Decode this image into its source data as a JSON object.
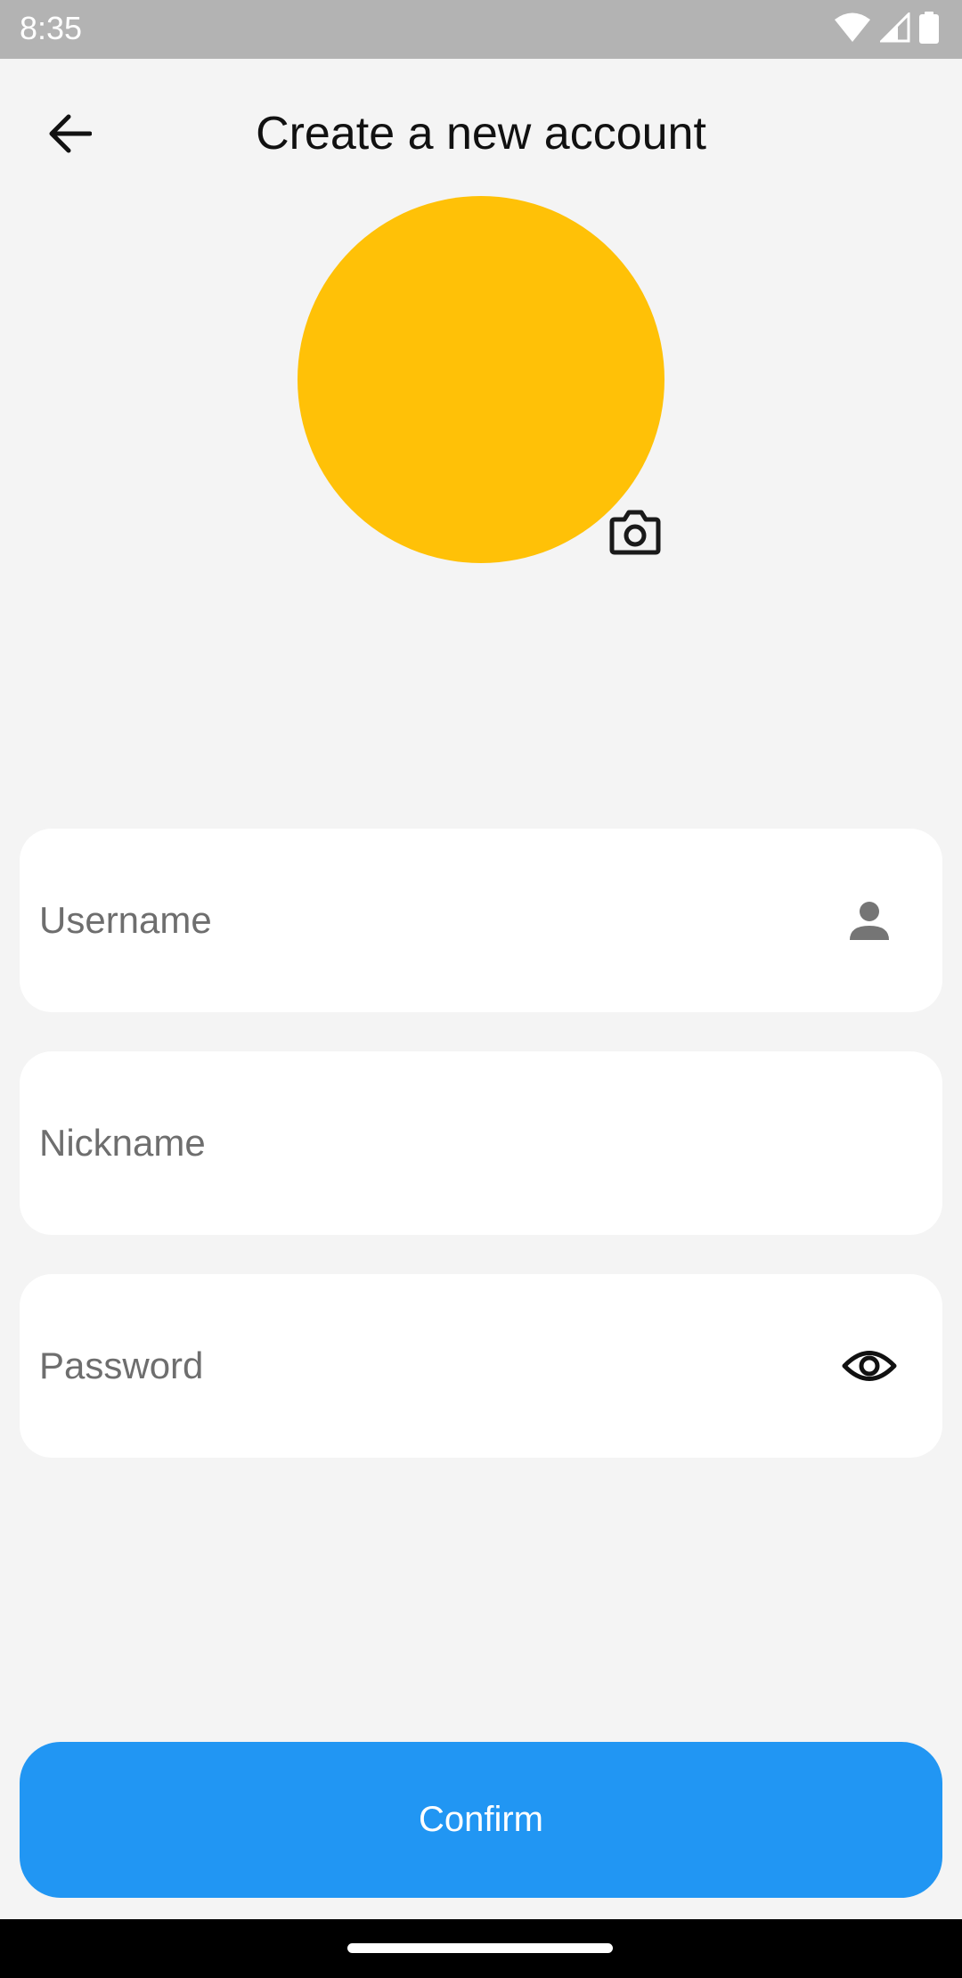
{
  "status_bar": {
    "time": "8:35",
    "icons": [
      "wifi-icon",
      "signal-icon",
      "battery-icon"
    ]
  },
  "header": {
    "title": "Create a new account",
    "back_icon": "arrow-back-icon"
  },
  "avatar": {
    "color": "#FFC107",
    "camera_icon": "camera-icon"
  },
  "form": {
    "username": {
      "placeholder": "Username",
      "value": "",
      "icon": "person-icon"
    },
    "nickname": {
      "placeholder": "Nickname",
      "value": ""
    },
    "password": {
      "placeholder": "Password",
      "value": "",
      "icon": "eye-icon"
    }
  },
  "confirm_button": {
    "label": "Confirm",
    "color": "#2196F3"
  },
  "colors": {
    "background": "#F4F4F4",
    "field_background": "#FFFFFF",
    "status_bar": "#B3B3B3",
    "accent": "#2196F3",
    "avatar": "#FFC107"
  }
}
